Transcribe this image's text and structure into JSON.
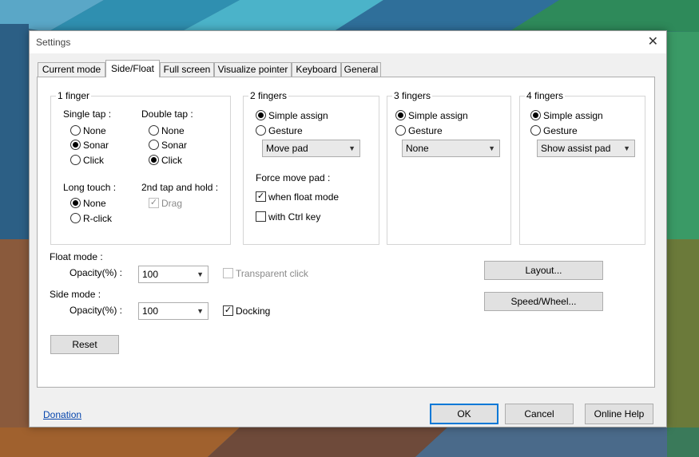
{
  "window": {
    "title": "Settings"
  },
  "tabs": [
    "Current mode",
    "Side/Float",
    "Full screen",
    "Visualize pointer",
    "Keyboard",
    "General"
  ],
  "one_finger": {
    "title": "1 finger",
    "single_tap": {
      "label": "Single tap :",
      "options": [
        "None",
        "Sonar",
        "Click"
      ],
      "selected": "Sonar"
    },
    "double_tap": {
      "label": "Double tap :",
      "options": [
        "None",
        "Sonar",
        "Click"
      ],
      "selected": "Click"
    },
    "long_touch": {
      "label": "Long touch :",
      "options": [
        "None",
        "R-click"
      ],
      "selected": "None"
    },
    "second_tap_hold": {
      "label": "2nd tap and hold :",
      "drag_label": "Drag",
      "drag_checked": true
    }
  },
  "two_fingers": {
    "title": "2 fingers",
    "options": [
      "Simple assign",
      "Gesture"
    ],
    "selected": "Simple assign",
    "select_value": "Move pad",
    "force_move_pad": {
      "label": "Force move pad :",
      "when_float": {
        "label": "when float mode",
        "checked": true
      },
      "ctrl_key": {
        "label": "with Ctrl key",
        "checked": false
      }
    }
  },
  "three_fingers": {
    "title": "3 fingers",
    "options": [
      "Simple assign",
      "Gesture"
    ],
    "selected": "Simple assign",
    "select_value": "None"
  },
  "four_fingers": {
    "title": "4 fingers",
    "options": [
      "Simple assign",
      "Gesture"
    ],
    "selected": "Simple assign",
    "select_value": "Show assist pad"
  },
  "float_mode": {
    "label": "Float mode :",
    "opacity_label": "Opacity(%) :",
    "opacity_value": "100",
    "transparent_click": {
      "label": "Transparent click",
      "checked": false,
      "enabled": false
    }
  },
  "side_mode": {
    "label": "Side mode :",
    "opacity_label": "Opacity(%) :",
    "opacity_value": "100",
    "docking": {
      "label": "Docking",
      "checked": true
    }
  },
  "buttons": {
    "layout": "Layout...",
    "speed_wheel": "Speed/Wheel...",
    "reset": "Reset",
    "ok": "OK",
    "cancel": "Cancel",
    "online_help": "Online Help"
  },
  "donation": "Donation"
}
